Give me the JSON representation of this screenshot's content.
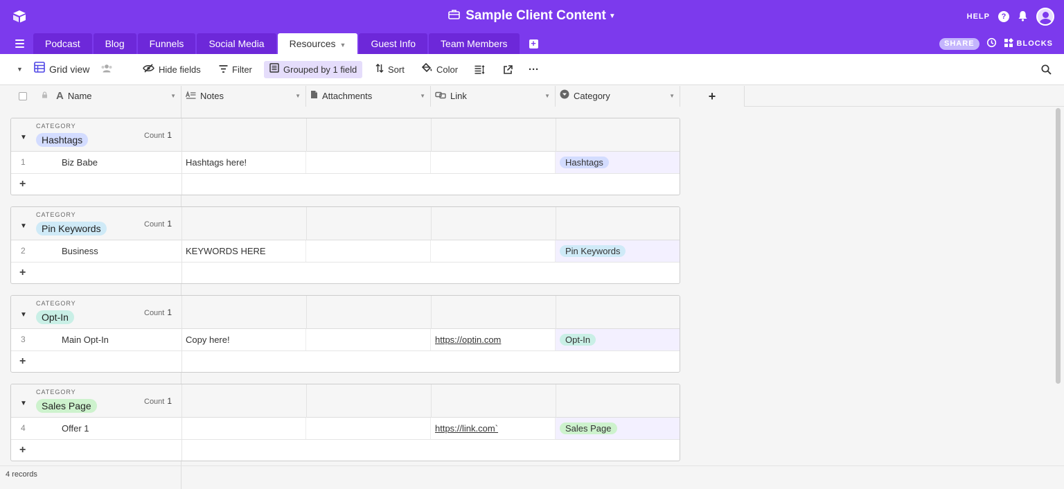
{
  "app": {
    "base_title": "Sample Client Content",
    "help_label": "HELP",
    "brand_color": "#7c3aed"
  },
  "tabs": [
    {
      "label": "Podcast"
    },
    {
      "label": "Blog"
    },
    {
      "label": "Funnels"
    },
    {
      "label": "Social Media"
    },
    {
      "label": "Resources",
      "active": true
    },
    {
      "label": "Guest Info"
    },
    {
      "label": "Team Members"
    }
  ],
  "tab_actions": {
    "share_label": "SHARE",
    "blocks_label": "BLOCKS"
  },
  "toolbar": {
    "view_name": "Grid view",
    "hide_fields": "Hide fields",
    "filter": "Filter",
    "grouped": "Grouped by 1 field",
    "sort": "Sort",
    "color": "Color"
  },
  "columns": [
    {
      "label": "Name",
      "icon": "text-icon"
    },
    {
      "label": "Notes",
      "icon": "long-text-icon"
    },
    {
      "label": "Attachments",
      "icon": "file-icon"
    },
    {
      "label": "Link",
      "icon": "link-icon"
    },
    {
      "label": "Category",
      "icon": "select-icon"
    }
  ],
  "groups": [
    {
      "label": "CATEGORY",
      "name": "Hashtags",
      "pill_color": "#d3dcff",
      "count_label": "Count",
      "count": "1",
      "row": {
        "num": "1",
        "name": "Biz Babe",
        "notes": "Hashtags here!",
        "link": "",
        "category": "Hashtags"
      }
    },
    {
      "label": "CATEGORY",
      "name": "Pin Keywords",
      "pill_color": "#cfeaf7",
      "count_label": "Count",
      "count": "1",
      "row": {
        "num": "2",
        "name": "Business",
        "notes": "KEYWORDS HERE",
        "link": "",
        "category": "Pin Keywords"
      }
    },
    {
      "label": "CATEGORY",
      "name": "Opt-In",
      "pill_color": "#c9efe6",
      "count_label": "Count",
      "count": "1",
      "row": {
        "num": "3",
        "name": "Main Opt-In",
        "notes": "Copy here!",
        "link": "https://optin.com",
        "category": "Opt-In"
      }
    },
    {
      "label": "CATEGORY",
      "name": "Sales Page",
      "pill_color": "#cdf2cd",
      "count_label": "Count",
      "count": "1",
      "row": {
        "num": "4",
        "name": "Offer 1",
        "notes": "",
        "link": "https://link.com`",
        "category": "Sales Page"
      }
    }
  ],
  "footer": {
    "records": "4 records"
  }
}
